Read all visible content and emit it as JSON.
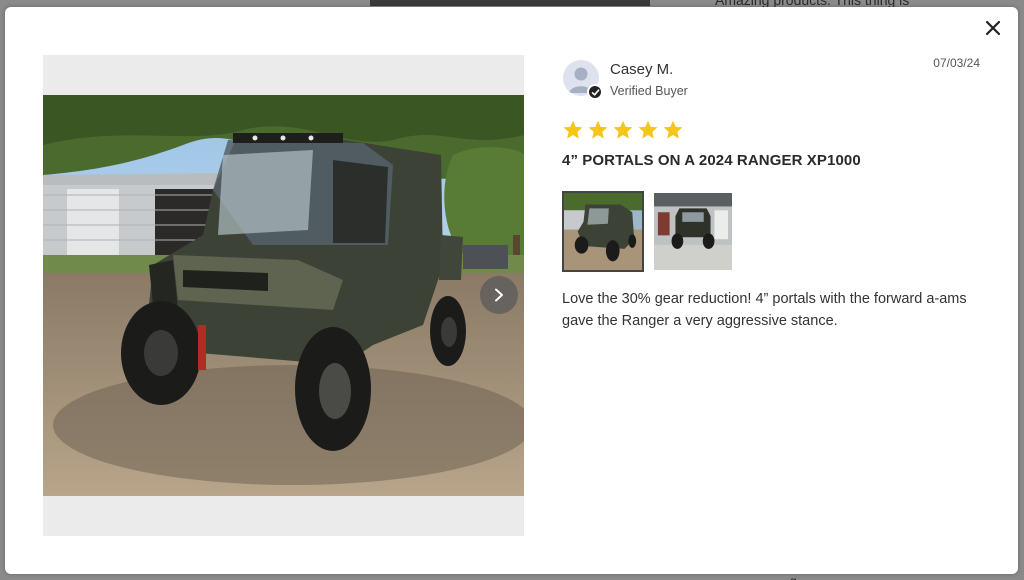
{
  "backdrop": {
    "top_text": "Amazing products. This thing is",
    "bottom_text": "g"
  },
  "modal": {
    "close_icon": "close-icon",
    "gallery": {
      "next_icon": "chevron-right-icon",
      "selected_index": 0
    },
    "review": {
      "reviewer_name": "Casey M.",
      "reviewer_status": "Verified Buyer",
      "date": "07/03/24",
      "rating": 5,
      "rating_max": 5,
      "star_color": "#f5c518",
      "title": "4” PORTALS ON A 2024 RANGER XP1000",
      "body": "Love the 30% gear reduction! 4” portals with the forward a-ams gave the Ranger a very aggressive stance.",
      "thumbnails": [
        "thumbnail-1",
        "thumbnail-2"
      ]
    }
  }
}
